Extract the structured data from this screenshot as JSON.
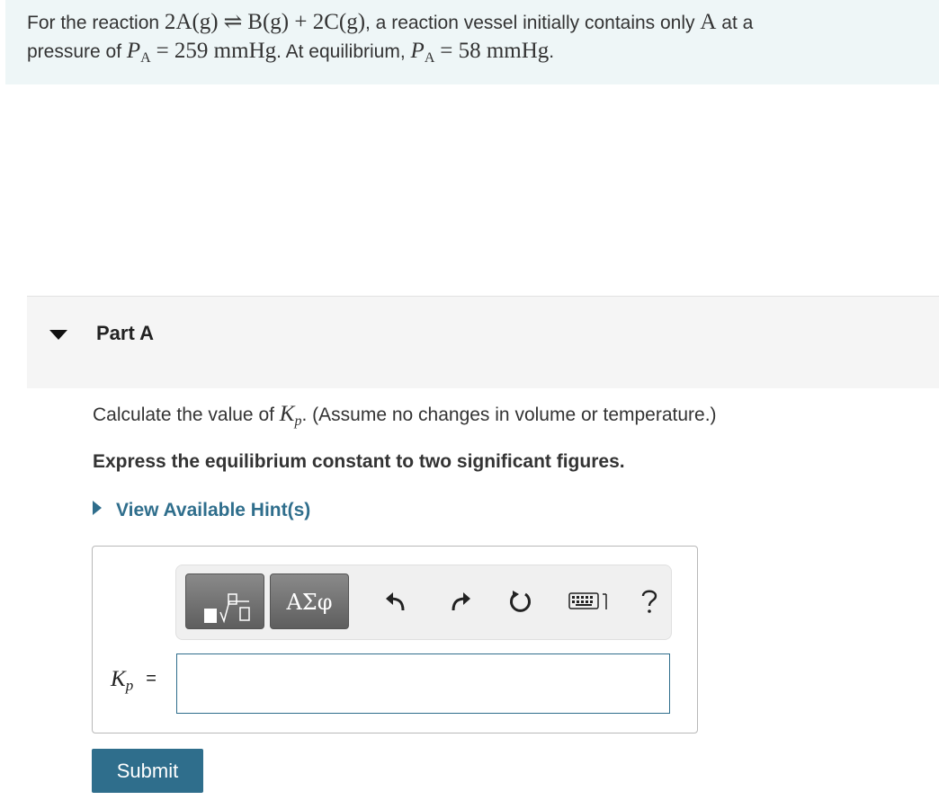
{
  "problem": {
    "t1": "For the reaction ",
    "reactant": "2A(g)",
    "arrow": "⇌",
    "products": "B(g) + 2C(g)",
    "t2": ", a reaction vessel initially contains only ",
    "species": "A",
    "t3": " at a",
    "t4": "pressure of ",
    "p_symbol": "P",
    "p_sub": "A",
    "initial_value": "= 259 mmHg",
    "t5": ". At equilibrium, ",
    "eq_value": "= 58 mmHg",
    "t6": "."
  },
  "part": {
    "title": "Part A"
  },
  "question": {
    "pre": "Calculate the value of ",
    "k_symbol": "K",
    "k_sub": "p",
    "post": ". (Assume no changes in volume or temperature.)"
  },
  "instruction": "Express the equilibrium constant to two significant figures.",
  "hint_link": "View Available Hint(s)",
  "toolbar": {
    "greek_label": "ΑΣφ"
  },
  "answer": {
    "label_symbol": "K",
    "label_sub": "p",
    "equals": "=",
    "value": ""
  },
  "submit_label": "Submit",
  "colors": {
    "accent": "#2f6e8c",
    "problem_bg": "#eef6f7",
    "part_bg": "#f5f5f5"
  }
}
